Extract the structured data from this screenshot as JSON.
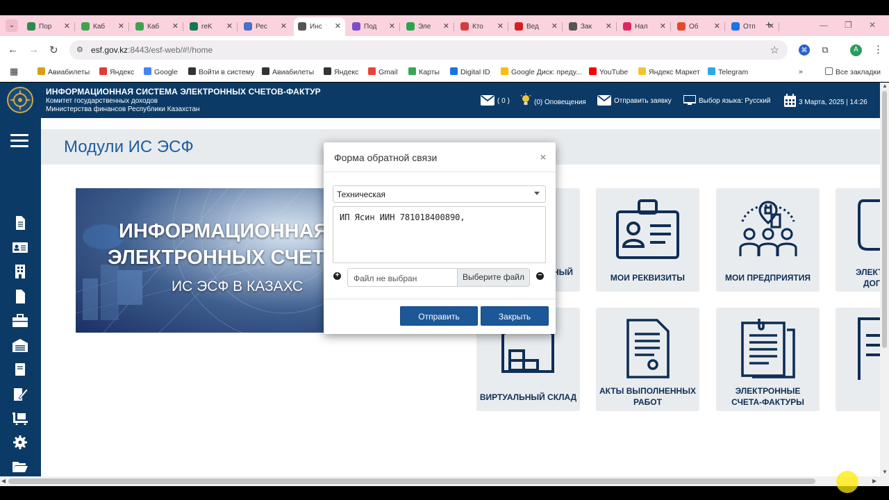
{
  "browser": {
    "tabs": [
      {
        "title": "Пор",
        "color": "#2d8a4e"
      },
      {
        "title": "Каб",
        "color": "#3fa34d"
      },
      {
        "title": "Каб",
        "color": "#3fa34d"
      },
      {
        "title": "reK",
        "color": "#117a55"
      },
      {
        "title": "Рес",
        "color": "#4c6fc8"
      },
      {
        "title": "Инс",
        "color": "#555555"
      },
      {
        "title": "Под",
        "color": "#7b4ec9"
      },
      {
        "title": "Эле",
        "color": "#2aa44f"
      },
      {
        "title": "Кто",
        "color": "#d33c3c"
      },
      {
        "title": "Вед",
        "color": "#d32020"
      },
      {
        "title": "Зак",
        "color": "#555555"
      },
      {
        "title": "Нал",
        "color": "#e0245e"
      },
      {
        "title": "Об",
        "color": "#e24a2b"
      },
      {
        "title": "Отп",
        "color": "#1a73e8"
      }
    ],
    "url_host": "esf.gov.kz",
    "url_path": ":8443/esf-web/#!/home",
    "profile_initial": "A",
    "bookmarks": [
      "Авиабилеты",
      "Яндекс",
      "Google",
      "Войти в систему",
      "Авиабилеты",
      "Яндекс",
      "Gmail",
      "Карты",
      "Digital ID",
      "Google Диск: преду...",
      "YouTube",
      "Яндекс Маркет",
      "Telegram"
    ],
    "bookmarks_more": "»",
    "all_bookmarks": "Все закладки"
  },
  "site": {
    "title": "ИНФОРМАЦИОННАЯ СИСТЕМА ЭЛЕКТРОННЫХ СЧЕТОВ-ФАКТУР",
    "subtitle1": "Комитет государственных доходов",
    "subtitle2": "Министерства финансов Республики Казахстан",
    "messages": "( 0 )",
    "notifications": "(0) Оповещения",
    "send_request": "Отправить заявку",
    "language": "Выбор языка: Русский",
    "datetime": "3 Марта, 2025 | 14:26",
    "page_title": "Модули ИС ЭСФ",
    "banner_line1": "ИНФОРМАЦИОННАЯ",
    "banner_line2": "ЭЛЕКТРОННЫХ СЧЕТО",
    "banner_line3": "ИС ЭСФ В КАЗАХС",
    "tile_partial": "НЫЙ",
    "tile_requisites": "МОИ РЕКВИЗИТЫ",
    "tile_enterprises": "МОИ ПРЕДПРИЯТИЯ",
    "tile_edge1_l1": "ЭЛЕКТ",
    "tile_edge1_l2": "ДОГ",
    "tile_warehouse": "ВИРТУАЛЬНЫЙ СКЛАД",
    "tile_acts_l1": "АКТЫ ВЫПОЛНЕННЫХ",
    "tile_acts_l2": "РАБОТ",
    "tile_invoices_l1": "ЭЛЕКТРОННЫЕ",
    "tile_invoices_l2": "СЧЕТА-ФАКТУРЫ"
  },
  "modal": {
    "title": "Форма обратной связи",
    "close": "×",
    "category": "Техническая",
    "message": "ИП Ясин ИИН 781018400890,",
    "file_status": "Файл не выбран",
    "file_button": "Выберите файл",
    "submit": "Отправить",
    "cancel": "Закрыть"
  }
}
